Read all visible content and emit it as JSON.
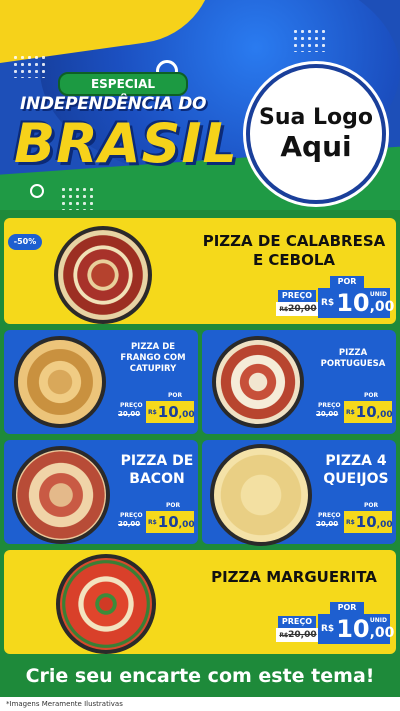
{
  "header": {
    "especial": "ESPECIAL",
    "title_line1": "INDEPENDÊNCIA DO",
    "title_line2": "BRASIL",
    "logo_line1": "Sua Logo",
    "logo_line2": "Aqui"
  },
  "products": [
    {
      "name": "PIZZA DE CALABRESA E CEBOLA",
      "badge": "-50%",
      "preco_label": "PREÇO",
      "old_price_prefix": "R$",
      "old_price": "20,00",
      "por_label": "POR",
      "currency": "R$",
      "price_int": "10",
      "price_dec": ",00",
      "unit": "UNID"
    },
    {
      "name": "PIZZA DE FRANGO COM CATUPIRY",
      "preco_label": "PREÇO",
      "old_price_prefix": "R$",
      "old_price": "20,00",
      "por_label": "POR",
      "currency": "R$",
      "price_int": "10",
      "price_dec": ",00",
      "unit": "UNID"
    },
    {
      "name": "PIZZA PORTUGUESA",
      "preco_label": "PREÇO",
      "old_price_prefix": "R$",
      "old_price": "20,00",
      "por_label": "POR",
      "currency": "R$",
      "price_int": "10",
      "price_dec": ",00",
      "unit": "UNID"
    },
    {
      "name": "PIZZA DE BACON",
      "preco_label": "PREÇO",
      "old_price_prefix": "R$",
      "old_price": "20,00",
      "por_label": "POR",
      "currency": "R$",
      "price_int": "10",
      "price_dec": ",00",
      "unit": "UNID"
    },
    {
      "name": "PIZZA 4 QUEIJOS",
      "preco_label": "PREÇO",
      "old_price_prefix": "R$",
      "old_price": "20,00",
      "por_label": "POR",
      "currency": "R$",
      "price_int": "10",
      "price_dec": ",00",
      "unit": "UNID"
    },
    {
      "name": "PIZZA MARGUERITA",
      "preco_label": "PREÇO",
      "old_price_prefix": "R$",
      "old_price": "20,00",
      "por_label": "POR",
      "currency": "R$",
      "price_int": "10",
      "price_dec": ",00",
      "unit": "UNID"
    }
  ],
  "cta": "Crie seu encarte com este tema!",
  "footnote": "*Imagens Meramente Ilustrativas",
  "colors": {
    "blue": "#1e5fd0",
    "yellow": "#f5d91b",
    "green": "#1e8a3a"
  }
}
